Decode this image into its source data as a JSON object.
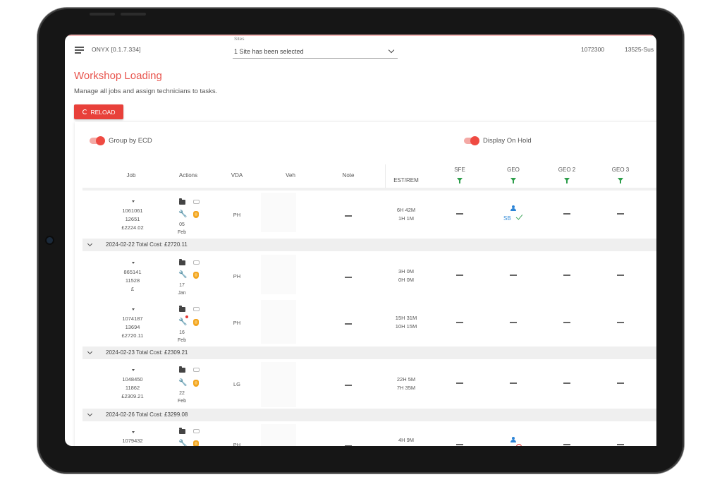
{
  "header": {
    "app_title": "ONYX [0.1.7.334]",
    "sites_label": "Sites",
    "sites_value": "1 Site has been selected",
    "user_id": "1072300",
    "user_name": "13525-Sus"
  },
  "page": {
    "title": "Workshop Loading",
    "subtitle": "Manage all jobs and assign technicians to tasks.",
    "reload_label": "RELOAD"
  },
  "toggles": {
    "group_by_ecd": "Group by ECD",
    "display_on_hold": "Display On Hold"
  },
  "columns": {
    "job": "Job",
    "actions": "Actions",
    "vda": "VDA",
    "veh": "Veh",
    "note": "Note",
    "est_rem": "EST/REM",
    "sfe": "SFE",
    "geo": "GEO",
    "geo2": "GEO 2",
    "geo3": "GEO 3"
  },
  "groups": [
    {
      "label": "2024-02-22 Total Cost: £2720.11"
    },
    {
      "label": "2024-02-23 Total Cost: £2309.21"
    },
    {
      "label": "2024-02-26 Total Cost: £3299.08"
    }
  ],
  "rows": [
    {
      "job_no": "1061061",
      "ref": "12651",
      "cost": "£2224.02",
      "day": "05",
      "month": "Feb",
      "vda": "PH",
      "est": "6H 42M",
      "rem": "1H 1M",
      "geo_initials": "SB"
    },
    {
      "job_no": "865141",
      "ref": "11528",
      "cost": "£",
      "day": "17",
      "month": "Jan",
      "vda": "PH",
      "est": "3H 0M",
      "rem": "0H 0M"
    },
    {
      "job_no": "1074187",
      "ref": "13694",
      "cost": "£2720.11",
      "day": "16",
      "month": "Feb",
      "vda": "PH",
      "est": "15H 31M",
      "rem": "10H 15M"
    },
    {
      "job_no": "1048450",
      "ref": "11862",
      "cost": "£2309.21",
      "day": "22",
      "month": "Feb",
      "vda": "LG",
      "est": "22H 5M",
      "rem": "7H 35M"
    },
    {
      "job_no": "1079432",
      "vda": "PH",
      "est": "4H 9M"
    }
  ],
  "icons": {
    "menu": "menu-icon",
    "reload": "refresh-icon",
    "filter": "filter-icon",
    "job_card": "folder-icon",
    "vehicle": "car-icon",
    "wrench": "wrench-icon",
    "hold": "hand-icon",
    "technician": "person-icon",
    "done": "check-icon"
  },
  "colors": {
    "accent": "#e8403a",
    "title": "#e8554e",
    "filter": "#2e9e4b",
    "wrench_green": "#2e9e4b",
    "wrench_orange": "#f3a51f",
    "technician": "#2c84d6"
  }
}
